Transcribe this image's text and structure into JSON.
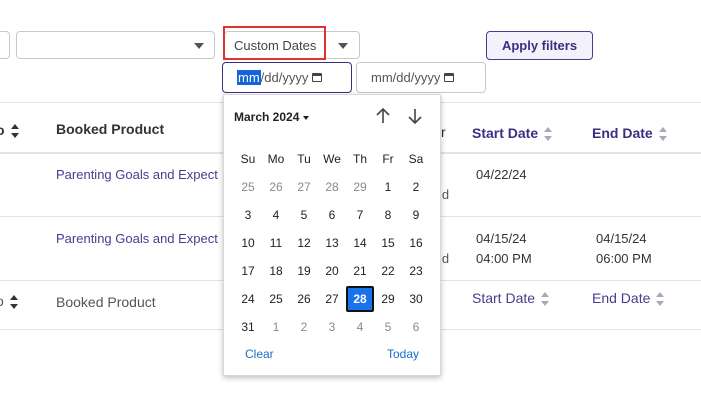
{
  "filters": {
    "custom_dates_label": "Custom Dates",
    "start_date_placeholder_parts": [
      "mm",
      "/dd/yyyy"
    ],
    "end_date_placeholder": "mm/dd/yyyy",
    "apply_label": "Apply filters"
  },
  "table": {
    "headers": {
      "booked_product": "Booked Product",
      "start_date": "Start Date",
      "end_date": "End Date"
    },
    "rows": [
      {
        "product": "Parenting Goals and Expect",
        "partial": "ld",
        "start_date": "04/22/24",
        "start_time": "",
        "end_date": "",
        "end_time": ""
      },
      {
        "product": "Parenting Goals and Expect",
        "partial": "ld",
        "start_date": "04/15/24",
        "start_time": "04:00 PM",
        "end_date": "04/15/24",
        "end_time": "06:00 PM"
      }
    ],
    "footer": {
      "booked_product": "Booked Product",
      "start_date": "Start Date",
      "end_date": "End Date"
    }
  },
  "datepicker": {
    "month_label": "March 2024",
    "weekdays": [
      "Su",
      "Mo",
      "Tu",
      "We",
      "Th",
      "Fr",
      "Sa"
    ],
    "weeks": [
      [
        "25",
        "26",
        "27",
        "28",
        "29",
        "1",
        "2"
      ],
      [
        "3",
        "4",
        "5",
        "6",
        "7",
        "8",
        "9"
      ],
      [
        "10",
        "11",
        "12",
        "13",
        "14",
        "15",
        "16"
      ],
      [
        "17",
        "18",
        "19",
        "20",
        "21",
        "22",
        "23"
      ],
      [
        "24",
        "25",
        "26",
        "27",
        "28",
        "29",
        "30"
      ],
      [
        "31",
        "1",
        "2",
        "3",
        "4",
        "5",
        "6"
      ]
    ],
    "selected_day": "28",
    "clear_label": "Clear",
    "today_label": "Today"
  },
  "colors": {
    "accent": "#3d2e84",
    "selected_day": "#1a73e8",
    "highlight": "#e53030"
  }
}
